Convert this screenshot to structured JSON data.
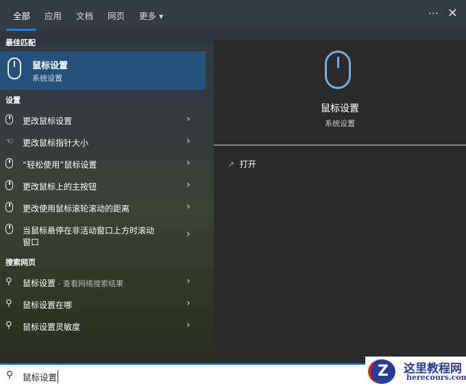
{
  "tabs": [
    {
      "label": "全部"
    },
    {
      "label": "应用"
    },
    {
      "label": "文档"
    },
    {
      "label": "网页"
    },
    {
      "label": "更多 ▾"
    }
  ],
  "window": {
    "more": "···",
    "close": "✕"
  },
  "best_match": {
    "header": "最佳匹配",
    "title": "鼠标设置",
    "subtitle": "系统设置"
  },
  "settings": {
    "header": "设置",
    "items": [
      {
        "label": "更改鼠标设置",
        "icon": "mouse-icon"
      },
      {
        "label": "更改鼠标指针大小",
        "icon": "pointer-icon"
      },
      {
        "label": "“轻松使用”鼠标设置",
        "icon": "mouse-icon"
      },
      {
        "label": "更改鼠标上的主按钮",
        "icon": "mouse-icon"
      },
      {
        "label": "更改使用鼠标滚轮滚动的距离",
        "icon": "mouse-icon"
      },
      {
        "label": "当鼠标悬停在非活动窗口上方时滚动",
        "label2": "窗口",
        "icon": "mouse-icon"
      }
    ]
  },
  "web": {
    "header": "搜索网页",
    "items": [
      {
        "label": "鼠标设置",
        "suffix": " - 查看网络搜索结果"
      },
      {
        "label": "鼠标设置在哪"
      },
      {
        "label": "鼠标设置灵敏度"
      }
    ]
  },
  "preview": {
    "title": "鼠标设置",
    "subtitle": "系统设置",
    "action": "打开"
  },
  "search": {
    "value": "鼠标设置"
  },
  "watermark": {
    "title": "这里教程网",
    "url": "herecours.com"
  },
  "colors": {
    "accent": "#1a7fd6",
    "selected": "#24527b"
  }
}
